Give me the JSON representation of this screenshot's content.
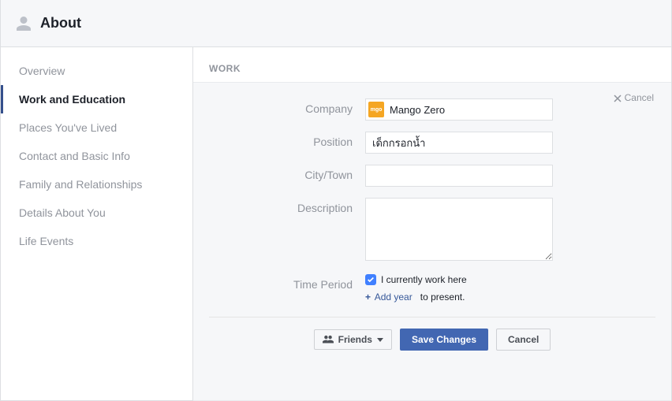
{
  "header": {
    "title": "About"
  },
  "sidebar": {
    "items": [
      {
        "label": "Overview"
      },
      {
        "label": "Work and Education"
      },
      {
        "label": "Places You've Lived"
      },
      {
        "label": "Contact and Basic Info"
      },
      {
        "label": "Family and Relationships"
      },
      {
        "label": "Details About You"
      },
      {
        "label": "Life Events"
      }
    ]
  },
  "main": {
    "section_title": "WORK",
    "cancel_top": "Cancel",
    "form": {
      "company_label": "Company",
      "company_value": "Mango Zero",
      "position_label": "Position",
      "position_value": "เด็กกรอกน้ำ",
      "city_label": "City/Town",
      "city_value": "",
      "description_label": "Description",
      "description_value": "",
      "time_label": "Time Period",
      "time_checkbox": "I currently work here",
      "add_year": "Add year",
      "to_present": "to present."
    },
    "footer": {
      "audience": "Friends",
      "save": "Save Changes",
      "cancel": "Cancel"
    }
  }
}
